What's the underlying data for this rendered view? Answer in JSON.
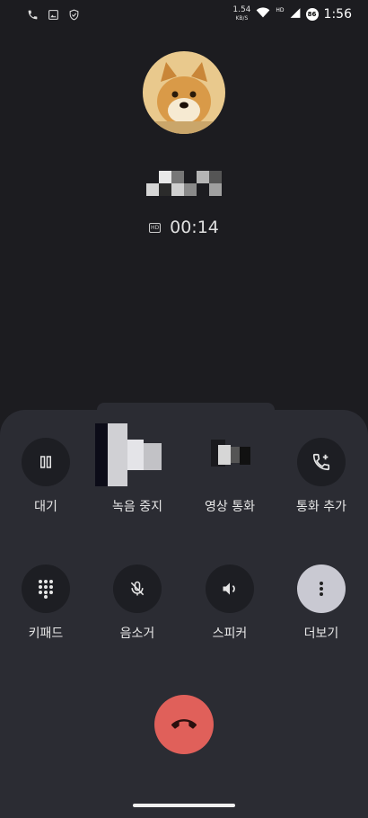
{
  "status_bar": {
    "net_speed_value": "1.54",
    "net_speed_unit": "KB/S",
    "hd_label": "HD",
    "battery_level": "86",
    "time": "1:56",
    "icons_left": [
      "phone-icon",
      "image-icon",
      "shield-icon"
    ],
    "icons_right": [
      "wifi-icon",
      "signal-icon",
      "battery-icon"
    ]
  },
  "call": {
    "duration": "00:14",
    "hd_icon_label": "HD"
  },
  "controls": {
    "row1": [
      {
        "label": "대기",
        "icon": "pause-icon"
      },
      {
        "label": "녹음 중지",
        "icon": "record-stop-icon"
      },
      {
        "label": "영상 통화",
        "icon": "video-call-icon"
      },
      {
        "label": "통화 추가",
        "icon": "add-call-icon"
      }
    ],
    "row2": [
      {
        "label": "키패드",
        "icon": "dialpad-icon"
      },
      {
        "label": "음소거",
        "icon": "mic-off-icon"
      },
      {
        "label": "스피커",
        "icon": "speaker-icon"
      },
      {
        "label": "더보기",
        "icon": "more-icon"
      }
    ]
  },
  "colors": {
    "background": "#1c1c20",
    "panel": "#2b2c33",
    "end_call": "#e0605a",
    "active_button": "#c9c9d2"
  }
}
